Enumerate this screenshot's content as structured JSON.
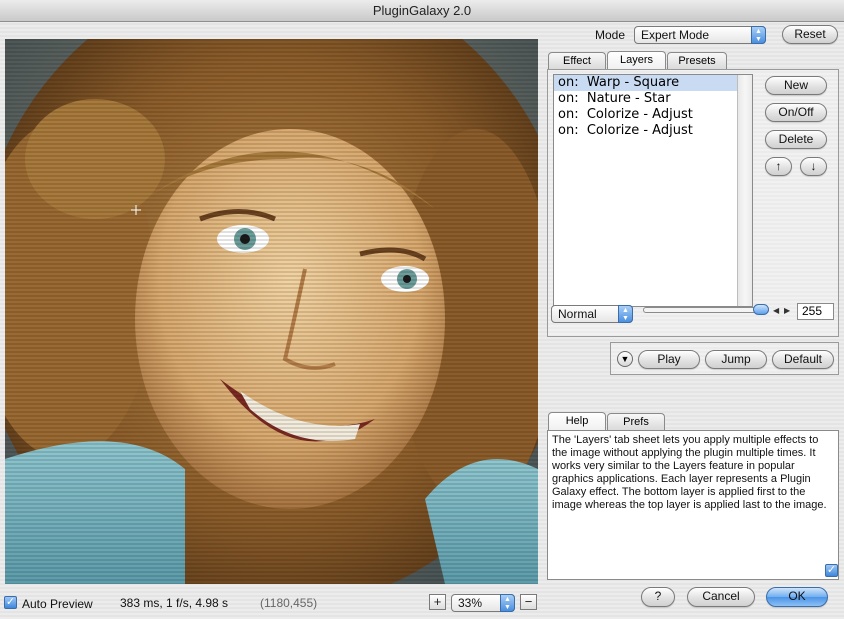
{
  "window": {
    "title": "PluginGalaxy 2.0"
  },
  "mode": {
    "label": "Mode",
    "value": "Expert Mode"
  },
  "reset_label": "Reset",
  "tabs": [
    {
      "label": "Effect",
      "active": false
    },
    {
      "label": "Layers",
      "active": true
    },
    {
      "label": "Presets",
      "active": false
    }
  ],
  "layers": {
    "items": [
      {
        "state": "on:",
        "name": "Warp - Square",
        "selected": true
      },
      {
        "state": "on:",
        "name": "Nature - Star",
        "selected": false
      },
      {
        "state": "on:",
        "name": "Colorize - Adjust",
        "selected": false
      },
      {
        "state": "on:",
        "name": "Colorize - Adjust",
        "selected": false
      }
    ],
    "new_label": "New",
    "onoff_label": "On/Off",
    "delete_label": "Delete",
    "up_icon": "arrow-up-icon",
    "down_icon": "arrow-down-icon"
  },
  "blend": {
    "mode": "Normal",
    "opacity": "255"
  },
  "playback": {
    "play_label": "Play",
    "jump_label": "Jump",
    "default_label": "Default"
  },
  "help_tabs": [
    {
      "label": "Help",
      "active": true
    },
    {
      "label": "Prefs",
      "active": false
    }
  ],
  "help_text": "The 'Layers' tab sheet lets you apply multiple effects to the image without applying the plugin multiple times. It works very similar to the Layers feature in popular graphics applications. Each layer represents a Plugin Galaxy effect. The bottom layer is applied first to the image whereas the top layer is applied last to the image.",
  "status": {
    "auto_preview_label": "Auto Preview",
    "timing": "383 ms, 1 f/s, 4.98 s",
    "coords": "(1180,455)",
    "zoom": "33%"
  },
  "footer": {
    "help_label": "?",
    "cancel_label": "Cancel",
    "ok_label": "OK"
  },
  "colors": {
    "accent": "#4b93e6",
    "selection": "#c9dbf2"
  }
}
